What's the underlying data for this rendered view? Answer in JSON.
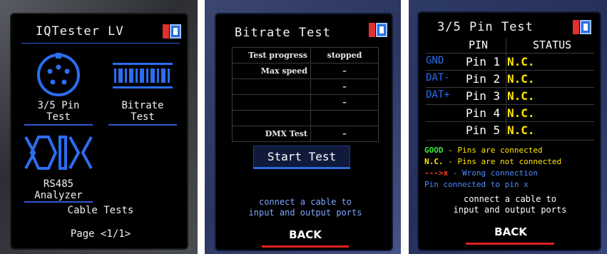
{
  "panel1": {
    "title": "IQTester LV",
    "tiles": [
      {
        "label_line1": "3/5 Pin",
        "label_line2": "Test",
        "icon": "dmx-connector-icon"
      },
      {
        "label_line1": "Bitrate",
        "label_line2": "Test",
        "icon": "barcode-bits-icon"
      },
      {
        "label_line1": "RS485",
        "label_line2": "Analyzer",
        "icon": "rs485-signal-icon"
      }
    ],
    "cable_tests": "Cable Tests",
    "page": "Page <1/1>"
  },
  "panel2": {
    "title": "Bitrate Test",
    "rows": [
      {
        "key": "Test progress",
        "value": "stopped"
      },
      {
        "key": "Max speed",
        "value": "–"
      },
      {
        "key": "",
        "value": "–"
      },
      {
        "key": "",
        "value": "–"
      },
      {
        "key": "",
        "value": ""
      },
      {
        "key": "DMX Test",
        "value": "–"
      }
    ],
    "start_button": "Start Test",
    "hint_line1": "connect a cable to",
    "hint_line2": "input and output ports",
    "back": "BACK"
  },
  "panel3": {
    "title": "3/5 Pin Test",
    "col_pin": "PIN",
    "col_status": "STATUS",
    "rows": [
      {
        "sig": "GND",
        "pin": "Pin 1",
        "status": "N.C."
      },
      {
        "sig": "DAT-",
        "pin": "Pin 2",
        "status": "N.C."
      },
      {
        "sig": "DAT+",
        "pin": "Pin 3",
        "status": "N.C."
      },
      {
        "sig": "",
        "pin": "Pin 4",
        "status": "N.C."
      },
      {
        "sig": "",
        "pin": "Pin 5",
        "status": "N.C."
      }
    ],
    "legend": [
      {
        "key": "GOOD",
        "text": " - Pins are connected",
        "color": "#39e639"
      },
      {
        "key": "N.C.",
        "text": " - Pins are not connected",
        "color": "#ffe600"
      },
      {
        "key": "--->x",
        "text": " - Wrong connection",
        "color": "#ff3a1a"
      }
    ],
    "legend_extra": "Pin connected to pin x",
    "hint_line1": "connect a cable to",
    "hint_line2": "input and output ports",
    "back": "BACK"
  },
  "colors": {
    "accent_blue": "#2b58d8",
    "status_yellow": "#ffe600",
    "back_red": "#e02020"
  }
}
